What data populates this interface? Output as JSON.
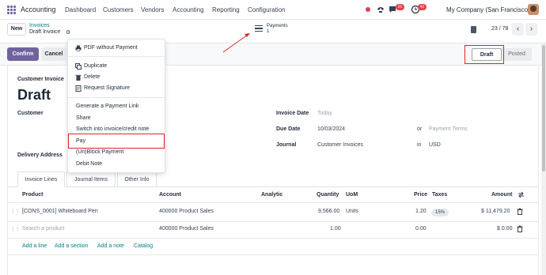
{
  "navbar": {
    "app_name": "Accounting",
    "menus": [
      "Dashboard",
      "Customers",
      "Vendors",
      "Accounting",
      "Reporting",
      "Configuration"
    ],
    "chat_count": "21",
    "activity_count": "41",
    "company": "My Company (San Francisco)"
  },
  "control_panel": {
    "new_label": "New",
    "breadcrumb_parent": "Invoices",
    "breadcrumb_current": "Draft Invoice",
    "payments_label": "Payments",
    "payments_count": "1",
    "pager": "23 / 78"
  },
  "actions": {
    "confirm_label": "Confirm",
    "cancel_label": "Cancel",
    "status_draft": "Draft",
    "status_posted": "Posted"
  },
  "form": {
    "type_label": "Customer Invoice",
    "title": "Draft",
    "customer_label": "Customer",
    "delivery_label": "Delivery Address",
    "invoice_date_label": "Invoice Date",
    "invoice_date_placeholder": "Today",
    "due_date_label": "Due Date",
    "due_date_value": "10/03/2024",
    "or_label": "or",
    "payment_terms_placeholder": "Payment Terms",
    "journal_label": "Journal",
    "journal_value": "Customer Invoices",
    "in_label": "in",
    "currency_value": "USD"
  },
  "tabs": [
    "Invoice Lines",
    "Journal Items",
    "Other Info"
  ],
  "table": {
    "headers": {
      "product": "Product",
      "account": "Account",
      "analytic": "Analytic",
      "quantity": "Quantity",
      "uom": "UoM",
      "price": "Price",
      "taxes": "Taxes",
      "amount": "Amount"
    },
    "rows": [
      {
        "product": "[CONS_0001] Whiteboard Pen",
        "account": "400000 Product Sales",
        "quantity": "9,566.00",
        "uom": "Units",
        "price": "1.20",
        "tax": "15%",
        "amount": "$ 11,479.20"
      },
      {
        "product": "Search a product",
        "account": "400000 Product Sales",
        "quantity": "1.00",
        "uom": "",
        "price": "0.00",
        "tax": "",
        "amount": "$ 0.00"
      }
    ],
    "add_links": [
      "Add a line",
      "Add a section",
      "Add a note",
      "Catalog"
    ]
  },
  "dropdown": {
    "items": [
      "PDF without Payment",
      "Duplicate",
      "Delete",
      "Request Signature",
      "Generate a Payment Link",
      "Share",
      "Switch into invoice/credit note",
      "Pay",
      "(Un)Block Payment",
      "Debit Note"
    ]
  },
  "colors": {
    "brand": "#71639e",
    "link": "#017e84",
    "highlight": "#dc2626",
    "badge": "#e0434b"
  }
}
